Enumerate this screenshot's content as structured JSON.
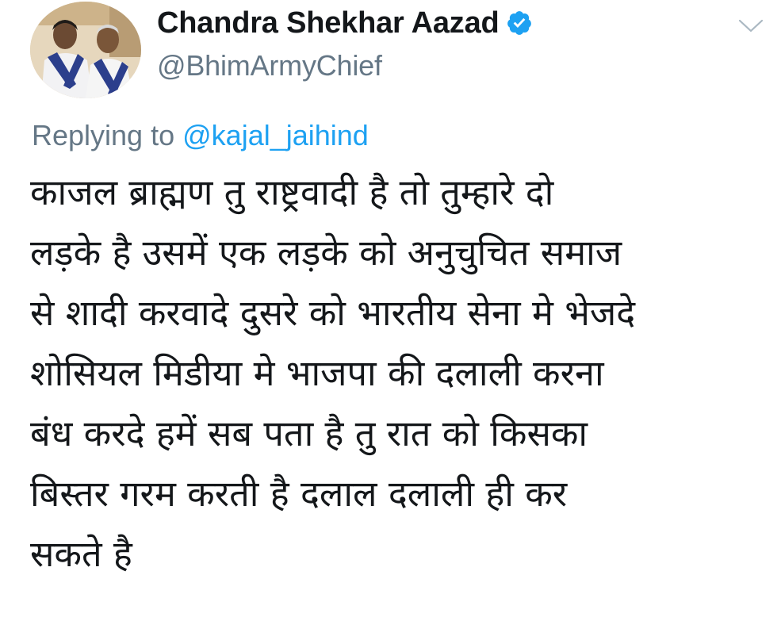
{
  "author": {
    "display_name": "Chandra Shekhar Aazad",
    "handle": "@BhimArmyChief",
    "verified": true
  },
  "reply": {
    "prefix": "Replying to",
    "mention": "@kajal_jaihind"
  },
  "tweet": {
    "lines": [
      "काजल ब्राह्मण तु राष्ट्रवादी है तो तुम्हारे दो",
      "लड़के है उसमें एक लड़के को अनुचुचित समाज",
      "से शादी करवादे दुसरे को भारतीय सेना मे भेजदे",
      "शोसियल मिडीया मे भाजपा की दलाली करना",
      "बंध करदे हमें सब पता है तु रात को किसका",
      "बिस्तर गरम करती है दलाल दलाली ही कर",
      "सकते है"
    ]
  },
  "icons": {
    "verified": "verified-badge-icon",
    "caret": "chevron-down-icon"
  },
  "colors": {
    "text": "#14171a",
    "secondary": "#657786",
    "link": "#1da1f2",
    "verified": "#1da1f2"
  }
}
